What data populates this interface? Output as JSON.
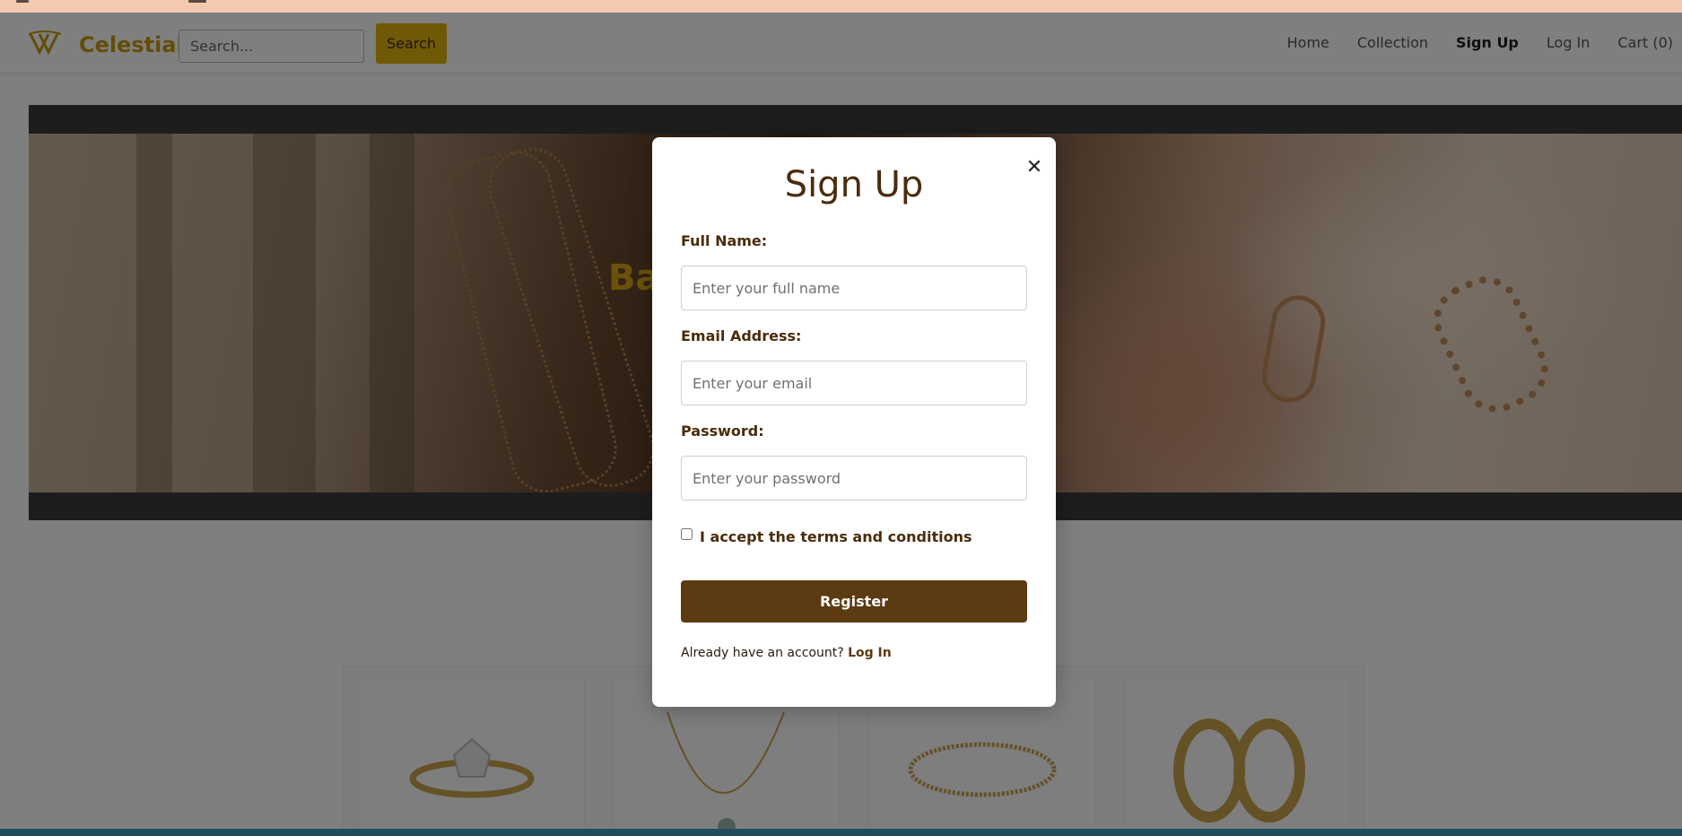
{
  "header": {
    "brand": "Celestial",
    "logo_icon": "diamond-icon",
    "search_placeholder": "Search...",
    "search_button": "Search",
    "nav": [
      "Home",
      "Collection",
      "Sign Up",
      "Log In",
      "Cart (0)"
    ],
    "active_nav": "Sign Up"
  },
  "hero": {
    "title": "Ba                                         ter"
  },
  "products": [
    {
      "name": "ring-image"
    },
    {
      "name": "necklace-image"
    },
    {
      "name": "bracelet-image"
    },
    {
      "name": "earrings-image"
    }
  ],
  "modal": {
    "title": "Sign Up",
    "close_icon": "close-icon",
    "full_name_label": "Full Name:",
    "full_name_placeholder": "Enter your full name",
    "email_label": "Email Address:",
    "email_placeholder": "Enter your email",
    "password_label": "Password:",
    "password_placeholder": "Enter your password",
    "terms_label": "I accept the terms and conditions",
    "register_button": "Register",
    "account_prompt": "Already have an account?",
    "login_link": "Log In"
  },
  "colors": {
    "brand": "#c79a10",
    "accent": "#e1b30c",
    "primary": "#5c3a12"
  }
}
